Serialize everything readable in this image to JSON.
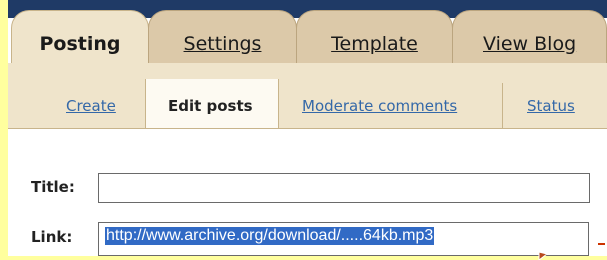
{
  "tabs": [
    {
      "label": "Posting",
      "active": true
    },
    {
      "label": "Settings",
      "active": false
    },
    {
      "label": "Template",
      "active": false
    },
    {
      "label": "View Blog",
      "active": false
    }
  ],
  "subtabs": [
    {
      "label": "Create",
      "active": false
    },
    {
      "label": "Edit posts",
      "active": true
    },
    {
      "label": "Moderate comments",
      "active": false
    },
    {
      "label": "Status",
      "active": false
    }
  ],
  "form": {
    "title_label": "Title:",
    "title_value": "",
    "link_label": "Link:",
    "link_value": "http://www.archive.org/download/.....64kb.mp3"
  },
  "colors": {
    "page_background": "#ffff9e",
    "tab_active": "#efe4cb",
    "tab_inactive": "#dcc9a9",
    "link_text": "#3468a8",
    "selection": "#316ac5"
  },
  "icons": {
    "cursor": "arrow-cursor-icon"
  }
}
